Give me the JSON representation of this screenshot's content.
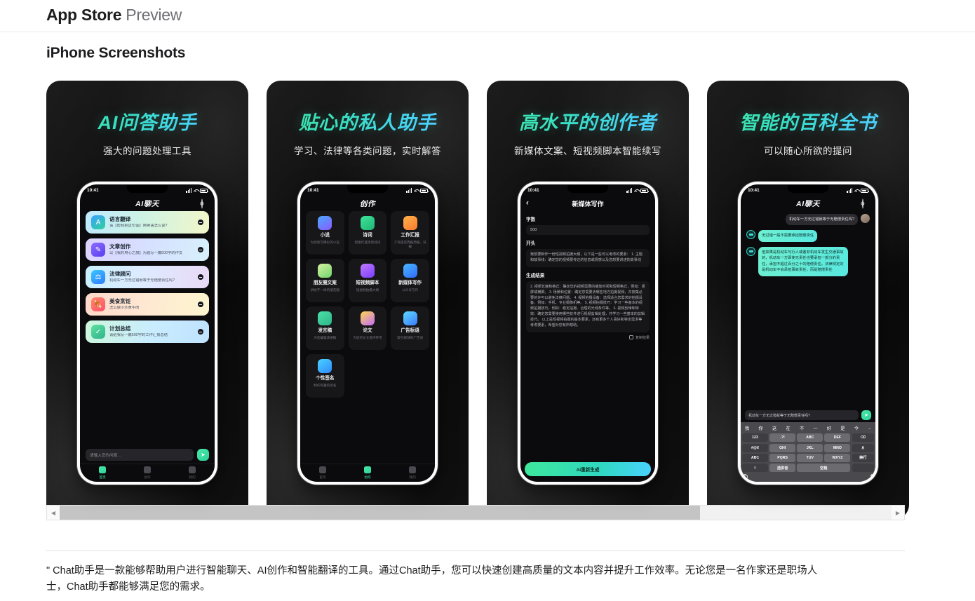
{
  "header": {
    "brand": "App Store",
    "brand_light": "Preview",
    "section_title": "iPhone Screenshots"
  },
  "scrollbar": {
    "left_arrow": "◀",
    "right_arrow": "▶"
  },
  "description": "\" Chat助手是一款能够帮助用户进行智能聊天、AI创作和智能翻译的工具。通过Chat助手，您可以快速创建高质量的文本内容并提升工作效率。无论您是一名作家还是职场人士，Chat助手都能够满足您的需求。",
  "screenshots": [
    {
      "headline": "AI问答助手",
      "subline": "强大的问题处理工具",
      "status_time": "10:41",
      "nav_title": "AI聊天",
      "cards": [
        {
          "title": "语言翻译",
          "sub": "请【帮我把这句话】用英语怎么说?"
        },
        {
          "title": "文章创作",
          "sub": "以【我的用心之旅】为题写一篇500字的作文"
        },
        {
          "title": "法律顾问",
          "sub": "机动车一方无过错就等于无赔偿责任吗?"
        },
        {
          "title": "美食烹饪",
          "sub": "怎么做小炒黄牛肉"
        },
        {
          "title": "计划总结",
          "sub": "请给我写一篇500字的工作汇报总结"
        }
      ],
      "composer_placeholder": "请输入您的问题…",
      "send_icon": "➤",
      "tabs": [
        {
          "label": "首页",
          "active": true
        },
        {
          "label": "创作",
          "active": false
        },
        {
          "label": "我的",
          "active": false
        }
      ]
    },
    {
      "headline": "贴心的私人助手",
      "subline": "学习、法律等各类问题，实时解答",
      "status_time": "10:41",
      "nav_title": "创作",
      "grid": [
        {
          "title": "小说",
          "sub": "为您续写精彩的小说"
        },
        {
          "title": "诗词",
          "sub": "智能作且情景诗词"
        },
        {
          "title": "工作汇报",
          "sub": "工作提案周报周报、日报"
        },
        {
          "title": "朋友圈文案",
          "sub": "讲述不一样的朋友圈"
        },
        {
          "title": "短视频脚本",
          "sub": "短视频拍摄大纲"
        },
        {
          "title": "新媒体写作",
          "sub": "公众号写作"
        },
        {
          "title": "发言稿",
          "sub": "为您编辑演讲稿"
        },
        {
          "title": "论文",
          "sub": "为您的论文提供参考"
        },
        {
          "title": "广告标语",
          "sub": "吸引眼球的广告语"
        },
        {
          "title": "个性签名",
          "sub": "制作有趣的签名"
        }
      ],
      "tabs": [
        {
          "label": "首页",
          "active": false
        },
        {
          "label": "创作",
          "active": true
        },
        {
          "label": "我的",
          "active": false
        }
      ]
    },
    {
      "headline": "高水平的创作者",
      "subline": "新媒体文案、短视频脚本智能续写",
      "status_time": "10:41",
      "nav_title": "新媒体写作",
      "back_icon": "‹",
      "word_count_label": "字数",
      "word_count_value": "500",
      "opening_label": "开头",
      "opening_text": "我想要制作一份短视频拍摄大纲，以下是一些可以考虑的要素：\n1. 主题和故事线：确定您的视频要传达的信息或情感以及您想要讲述的故事线",
      "result_label": "生成结果",
      "result_text": "2. 视频长度和格式：确定您的视频需要的播放时间和短频格式，例如：竖屏或横屏。\n3. 场景和位置：确定您需要去哪些地方拍摄视频，并搜集必要的许可以避免法律问题。\n4. 视频拍摄设备：选择适合您需求的拍摄设备，例如：手机、专业摄像机等。\n5. 视频拍摄技巧：学习一些基本的视频拍摄技巧，例如：稳定拍摄、合理的光线条件等。\n6. 视频剪辑和特效：确定您需要使用哪些软件进行视频剪辑处理，并学习一些基本的剪辑技巧。\n以上是短视频拍摄的基本要素，还有更多个人喜好和特定需求等考虑要素，希望对您有所帮助。",
      "copy_label": "复制结果",
      "generate_label": "AI重新生成"
    },
    {
      "headline": "智能的百科全书",
      "subline": "可以随心所欲的提问",
      "status_time": "10:41",
      "nav_title": "AI聊天",
      "messages": [
        {
          "role": "user",
          "text": "机动车一方无过错就等于无赔偿责任吗?"
        },
        {
          "role": "ai",
          "text": "无过错一般不需要承担赔偿责任"
        },
        {
          "role": "ai",
          "text": "但如果是机动车与行人或者非机动车发生交通事故的，机动车一方即使无责任也要承担一部分的责任，承担不超过百分之十的赔偿责任。法律规定的是机动车不会承担事故责任，而是赔偿责任"
        }
      ],
      "input_value": "机动车一方无过错就等于无赔偿责任吗?",
      "send_icon": "➤",
      "keyboard": {
        "suggestions": [
          "我",
          "你",
          "这",
          "在",
          "不",
          "一",
          "好",
          "是",
          "今"
        ],
        "caret": "⌄",
        "rows": [
          [
            "123",
            ".?!",
            "ABC",
            "DEF",
            "⌫"
          ],
          [
            "#@¥",
            "GHI",
            "JKL",
            "MNO",
            "A̲"
          ],
          [
            "ABC",
            "PQRS",
            "TUV",
            "WXYZ",
            "换行"
          ],
          [
            "☺",
            "选拼音",
            "空格",
            "",
            ""
          ]
        ]
      }
    }
  ]
}
